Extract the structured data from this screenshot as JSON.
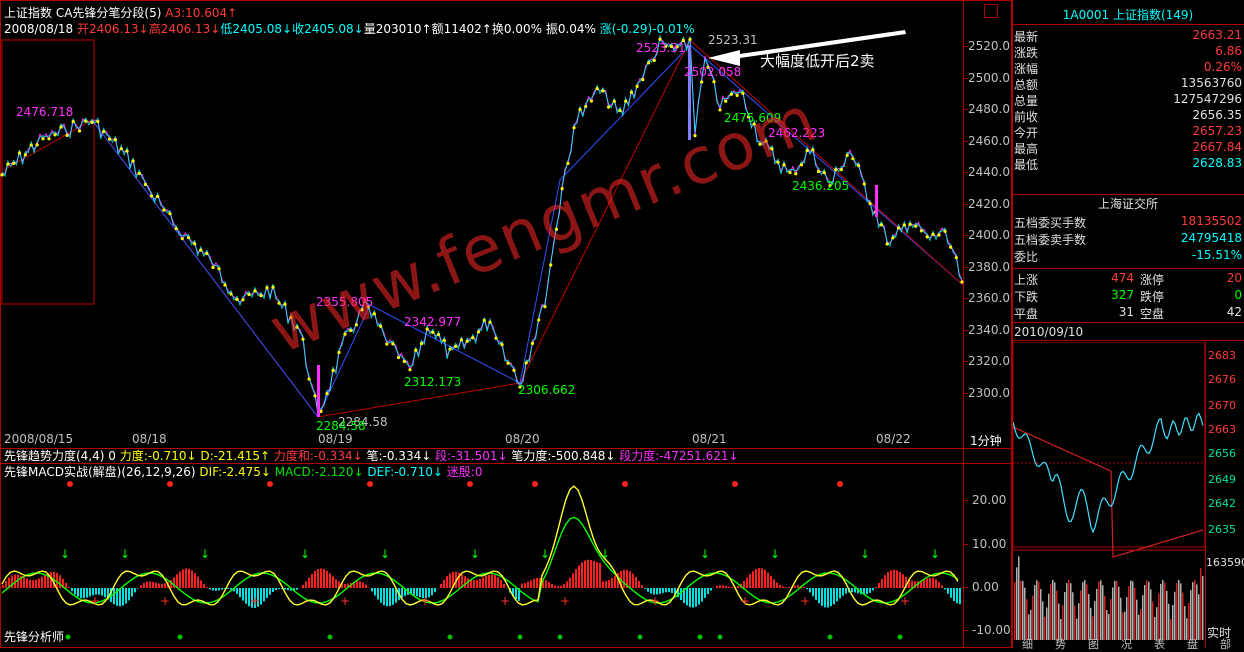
{
  "header": {
    "title": "上证指数",
    "subtitle": "CA先锋分笔分段(5)",
    "a3_label": "A3:",
    "a3_value": "10.604",
    "a3_arrow": "↑",
    "date": "2008/08/18",
    "open": "开2406.13↓",
    "high": "高2406.13↓",
    "low": "低2405.08↓",
    "close": "收2405.08↓",
    "volume": "量203010↑",
    "amount": "额11402↑",
    "turnover": "换0.00%",
    "amplitude": "振0.04%",
    "change": "涨(-0.29)-0.01%"
  },
  "main_chart": {
    "annotation": "大幅度低开后2卖",
    "price_labels": [
      {
        "text": "2476.718",
        "color": "#ff30ff"
      },
      {
        "text": "2355.805",
        "color": "#ff30ff"
      },
      {
        "text": "2342.977",
        "color": "#ff30ff"
      },
      {
        "text": "2312.173",
        "color": "#00ff00"
      },
      {
        "text": "2306.662",
        "color": "#00ff00"
      },
      {
        "text": "2284.58",
        "color": "#c0c0c0"
      },
      {
        "text": "2284.58",
        "color": "#00ff00"
      },
      {
        "text": "2523.31",
        "color": "#c0c0c0"
      },
      {
        "text": "2523.31",
        "color": "#ff30ff"
      },
      {
        "text": "2502.058",
        "color": "#ff30ff"
      },
      {
        "text": "2475.609",
        "color": "#00ff00"
      },
      {
        "text": "2462.223",
        "color": "#ff30ff"
      },
      {
        "text": "2436.205",
        "color": "#00ff00"
      }
    ],
    "y_axis": [
      "2520.0",
      "2500.0",
      "2480.0",
      "2460.0",
      "2440.0",
      "2420.0",
      "2400.0",
      "2380.0",
      "2360.0",
      "2340.0",
      "2320.0",
      "2300.0"
    ],
    "x_axis": [
      "2008/08/15",
      "08/18",
      "08/19",
      "08/20",
      "08/21",
      "08/22"
    ],
    "period": "1分钟"
  },
  "indicator_line": {
    "name": "先锋趋势力度(4,4)",
    "zero": "0",
    "force": "力度:-0.710↓",
    "d": "D:-21.415↑",
    "force_sum": "力度和:-0.334↓",
    "bi": "笔:-0.334↓",
    "duan": "段:-31.501↓",
    "bi_force": "笔力度:-500.848↓",
    "duan_force": "段力度:-47251.621↓"
  },
  "macd_line": {
    "name": "先锋MACD实战(解盘)(26,12,9,26)",
    "dif": "DIF:-2.475↓",
    "macd": "MACD:-2.120↓",
    "def": "DEF:-0.710↓",
    "extra": "迷殷:0",
    "y_axis": [
      "20.00",
      "10.00",
      "0.00",
      "-10.00"
    ],
    "footer": "先锋分析师"
  },
  "watermark": "www.fengmr.com",
  "side_panel": {
    "code_title": "1A0001 上证指数(149)",
    "quotes": [
      {
        "label": "最新",
        "value": "2663.21",
        "color": "#ff3b3b"
      },
      {
        "label": "涨跌",
        "value": "6.86",
        "color": "#ff3b3b"
      },
      {
        "label": "涨幅",
        "value": "0.26%",
        "color": "#ff3b3b"
      },
      {
        "label": "总额",
        "value": "13563760",
        "color": "#e0e0e0"
      },
      {
        "label": "总量",
        "value": "127547296",
        "color": "#e0e0e0"
      },
      {
        "label": "前收",
        "value": "2656.35",
        "color": "#e0e0e0"
      },
      {
        "label": "今开",
        "value": "2657.23",
        "color": "#ff3b3b"
      },
      {
        "label": "最高",
        "value": "2667.84",
        "color": "#ff3b3b"
      },
      {
        "label": "最低",
        "value": "2628.83",
        "color": "#00ffff"
      }
    ],
    "exchange": "上海证交所",
    "orders": [
      {
        "label": "五档委买手数",
        "value": "18135502",
        "color": "#ff3b3b"
      },
      {
        "label": "五档委卖手数",
        "value": "24795418",
        "color": "#00ffff"
      },
      {
        "label": "委比",
        "value": "-15.51%",
        "color": "#00ffff"
      }
    ],
    "breadth": [
      {
        "l1": "上涨",
        "v1": "474",
        "c1": "#ff3b3b",
        "l2": "涨停",
        "v2": "20",
        "c2": "#ff3b3b"
      },
      {
        "l1": "下跌",
        "v1": "327",
        "c1": "#00ff00",
        "l2": "跌停",
        "v2": "0",
        "c2": "#00ff00"
      },
      {
        "l1": "平盘",
        "v1": "31",
        "c1": "#e0e0e0",
        "l2": "空盘",
        "v2": "42",
        "c2": "#e0e0e0"
      }
    ],
    "mini_date": "2010/09/10",
    "mini_y": [
      "2683",
      "2676",
      "2670",
      "2663",
      "2656",
      "2649",
      "2642",
      "2635"
    ],
    "mini_vol": "163590",
    "realtime": "实时",
    "bottom_tabs": [
      "细",
      "势",
      "图",
      "况",
      "表",
      "盘",
      "部"
    ]
  }
}
